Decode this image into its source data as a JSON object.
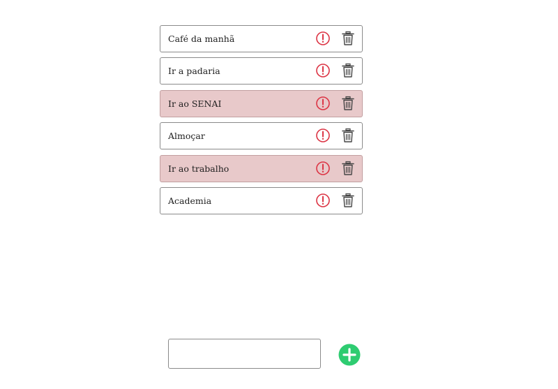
{
  "tasks": [
    {
      "text": "Café da manhã",
      "important": false
    },
    {
      "text": "Ir a padaria",
      "important": false
    },
    {
      "text": "Ir ao SENAI",
      "important": true
    },
    {
      "text": "Almoçar",
      "important": false
    },
    {
      "text": "Ir ao trabalho",
      "important": true
    },
    {
      "text": "Academia",
      "important": false
    }
  ],
  "icons": {
    "important": "exclamation-circle-icon",
    "delete": "trash-icon",
    "add": "plus-circle-icon"
  },
  "colors": {
    "important_icon": "#dc3545",
    "important_row_bg": "#e8c9ca",
    "delete_icon": "#444444",
    "add_button": "#2ecc71"
  },
  "new_task": {
    "value": "",
    "placeholder": ""
  }
}
